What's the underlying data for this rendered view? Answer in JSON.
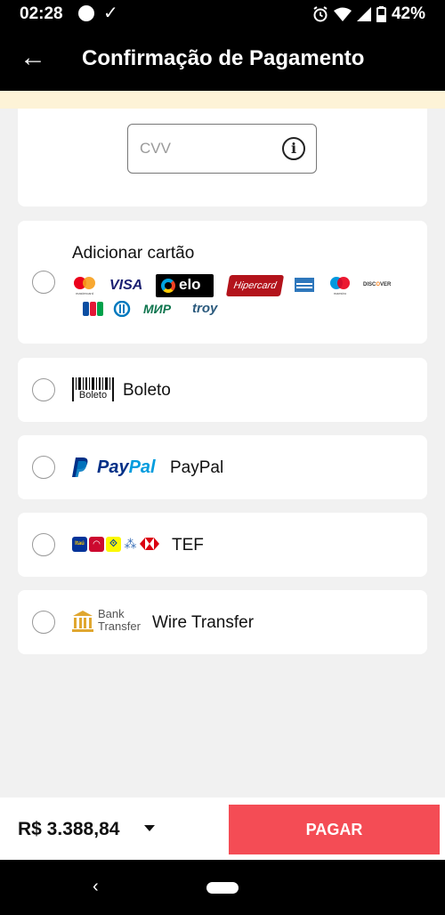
{
  "status_bar": {
    "time": "02:28",
    "battery": "42%"
  },
  "header": {
    "title": "Confirmação de Pagamento"
  },
  "cvv": {
    "placeholder": "CVV",
    "value": ""
  },
  "methods": {
    "card": {
      "label": "Adicionar cartão",
      "brands": [
        "mastercard",
        "VISA",
        "elo",
        "Hipercard",
        "AMERICAN EXPRESS",
        "maestro",
        "DISCOVER",
        "JCB",
        "Diners Club",
        "МИР",
        "troy"
      ]
    },
    "boleto": {
      "icon_text": "Boleto",
      "label": "Boleto"
    },
    "paypal": {
      "logo": "PayPal",
      "label": "PayPal"
    },
    "tef": {
      "icon_text": "Itaú",
      "label": "TEF"
    },
    "wire": {
      "icon_line1": "Bank",
      "icon_line2": "Transfer",
      "label": "Wire Transfer"
    }
  },
  "footer": {
    "total": "R$ 3.388,84",
    "pay_button": "PAGAR"
  },
  "colors": {
    "accent": "#f44c55",
    "header_bg": "#000000",
    "strip": "#fdf3d7"
  }
}
